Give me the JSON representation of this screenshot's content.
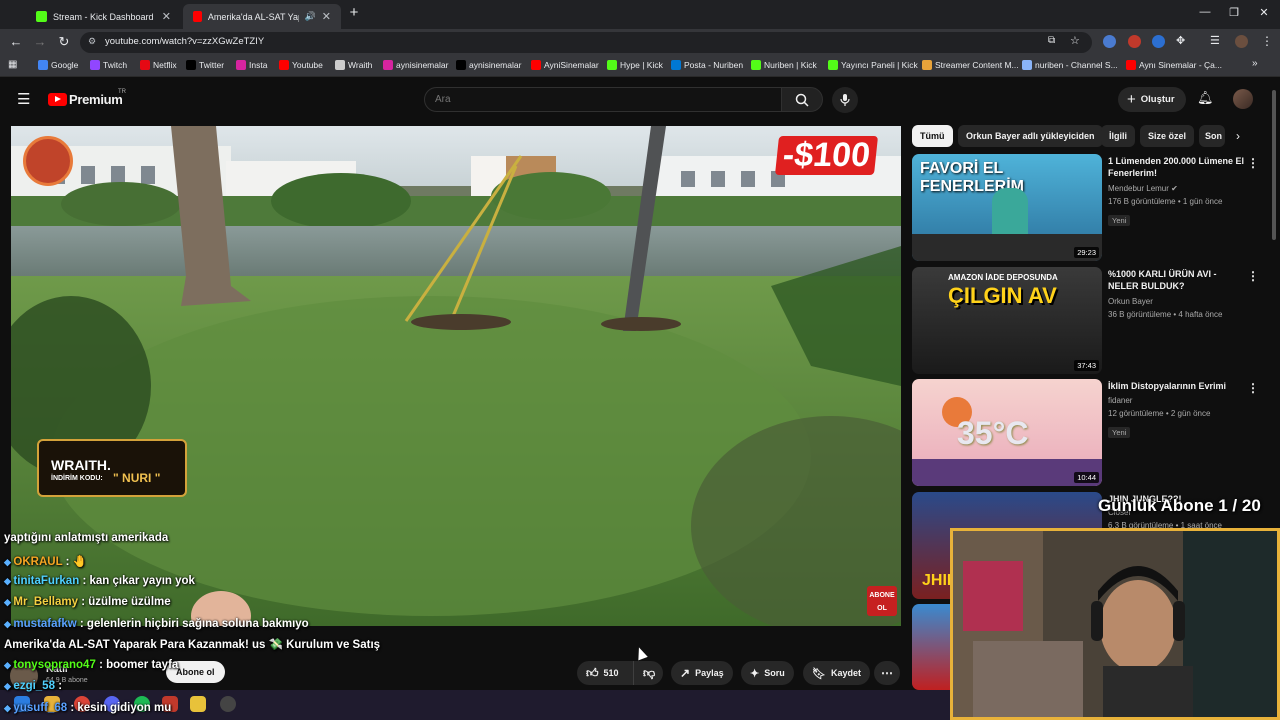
{
  "browser": {
    "tabs": [
      {
        "title": "Stream - Kick Dashboard",
        "favicon_color": "#53fc18",
        "active": false
      },
      {
        "title": "Amerika'da AL-SAT Yaparak",
        "favicon_color": "#ff0000",
        "active": true
      }
    ],
    "url": "youtube.com/watch?v=zzXGwZeTZIY",
    "bookmarks": [
      {
        "label": "Google",
        "color": "#4285f4"
      },
      {
        "label": "Twitch",
        "color": "#9146ff"
      },
      {
        "label": "Netflix",
        "color": "#e50914"
      },
      {
        "label": "Twitter",
        "color": "#000000"
      },
      {
        "label": "Insta",
        "color": "#d6249f"
      },
      {
        "label": "Youtube",
        "color": "#ff0000"
      },
      {
        "label": "Wraith",
        "color": "#cccccc"
      },
      {
        "label": "aynisinemalar",
        "color": "#d6249f"
      },
      {
        "label": "aynisinemalar",
        "color": "#000000"
      },
      {
        "label": "AyniSinemalar",
        "color": "#ff0000"
      },
      {
        "label": "Hype | Kick",
        "color": "#53fc18"
      },
      {
        "label": "Posta - Nuriben",
        "color": "#0078d4"
      },
      {
        "label": "Nuriben | Kick",
        "color": "#53fc18"
      },
      {
        "label": "Yayıncı Paneli | Kick",
        "color": "#53fc18"
      },
      {
        "label": "Streamer Content M...",
        "color": "#e8a33a"
      },
      {
        "label": "nuriben - Channel S...",
        "color": "#8ab4f8"
      },
      {
        "label": "Aynı Sinemalar - Ça...",
        "color": "#ff0000"
      }
    ]
  },
  "youtube": {
    "logo_text": "Premium",
    "logo_sup": "TR",
    "search_placeholder": "Ara",
    "create_label": "Oluştur",
    "channel": {
      "name": "Katıl",
      "subs": "64,9 B abone",
      "subscribe_label": "Abone ol"
    },
    "actions": {
      "likes": "510",
      "share": "Paylaş",
      "ask": "Soru",
      "save": "Kaydet"
    },
    "overlay": {
      "price_tag": "-$100",
      "abone_badge": "ABONE OL",
      "sponsor_brand": "WRAITH.",
      "sponsor_code_label": "İNDİRİM KODU:",
      "sponsor_code": "\" NURI \""
    },
    "chips": [
      "Tümü",
      "Orkun Bayer adlı yükleyiciden",
      "İlgili",
      "Size özel",
      "Son"
    ],
    "recommendations": [
      {
        "title": "1 Lümenden 200.000 Lümene El Fenerlerim!",
        "channel": "Mendebur Lemur",
        "verified": true,
        "meta": "176 B görüntüleme • 1 gün önce",
        "badge": "Yeni",
        "duration": "29:23",
        "thumb_text": "FAVORİ EL FENERLERİM"
      },
      {
        "title": "%1000 KARLI ÜRÜN AVI - NELER BULDUK?",
        "channel": "Orkun Bayer",
        "verified": false,
        "meta": "36 B görüntüleme • 4 hafta önce",
        "badge": "",
        "duration": "37:43",
        "thumb_text": "ÇILGIN AV",
        "thumb_sub": "AMAZON İADE DEPOSUNDA"
      },
      {
        "title": "İklim Distopyalarının Evrimi",
        "channel": "fidaner",
        "verified": false,
        "meta": "12 görüntüleme • 2 gün önce",
        "badge": "Yeni",
        "duration": "10:44",
        "thumb_text": "35°C"
      },
      {
        "title": "JHIN JUNGLE??!",
        "channel": "Closer",
        "verified": false,
        "meta": "6,3 B görüntüleme • 1 saat önce",
        "badge": "",
        "duration": "",
        "thumb_text": "JHIN"
      }
    ]
  },
  "stream_overlay": {
    "sub_goal": "Günlük Abone 1 / 20",
    "chat": [
      {
        "user": "",
        "message": "yaptığını anlatmıştı amerikada",
        "color": "#ffffff"
      },
      {
        "user": "OKRAUL",
        "message": ": 🤚",
        "color": "#f5a623"
      },
      {
        "user": "tinitaFurkan",
        "message": ": kan çıkar yayın yok",
        "color": "#4fd1ff"
      },
      {
        "user": "Mr_Bellamy",
        "message": ": üzülme üzülme",
        "color": "#f5d142"
      },
      {
        "user": "mustafafkw",
        "message": ": gelenlerin hiçbiri sağına soluna bakmıyo",
        "color": "#5aa0ff"
      },
      {
        "user": "",
        "message": "Amerika'da AL-SAT Yaparak Para Kazanmak! us 💸 Kurulum ve Satış",
        "color": "#ffffff"
      },
      {
        "user": "tonysoprano47",
        "message": ": boomer tayfa",
        "color": "#53fc18"
      },
      {
        "user": "ezgi_58",
        "message": ":",
        "color": "#4fd1ff"
      },
      {
        "user": "yusuff_68",
        "message": ": kesin gidiyon mu",
        "color": "#5aa0ff"
      }
    ]
  }
}
